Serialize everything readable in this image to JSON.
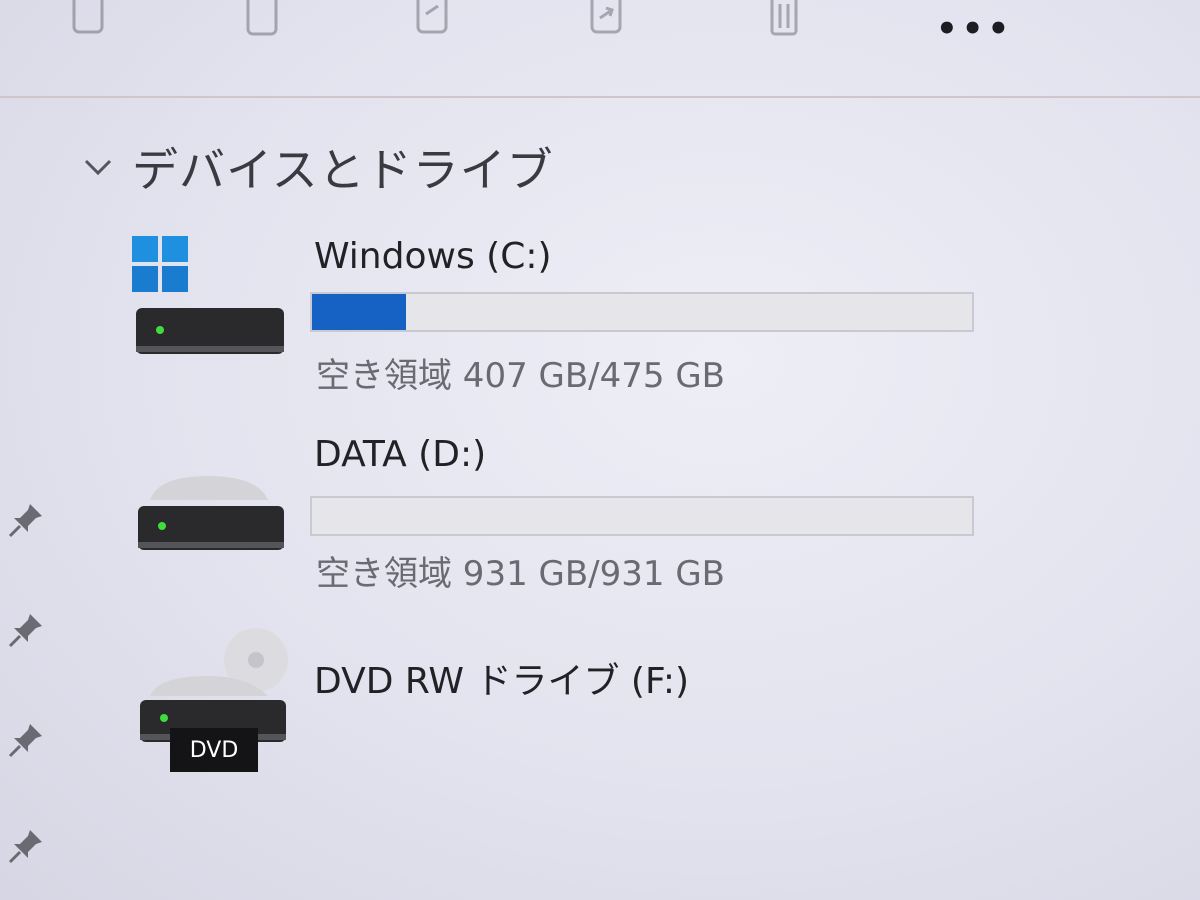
{
  "toolbar": {
    "icons": [
      "cut-icon",
      "copy-icon",
      "rename-icon",
      "share-icon",
      "delete-icon"
    ],
    "more_label": "•••"
  },
  "section": {
    "title": "デバイスとドライブ",
    "expanded": true
  },
  "drives": [
    {
      "name": "Windows (C:)",
      "space_text": "空き領域 407 GB/475 GB",
      "used_fraction": 0.143,
      "icon": "windows-drive-icon"
    },
    {
      "name": "DATA (D:)",
      "space_text": "空き領域 931 GB/931 GB",
      "used_fraction": 0.0,
      "icon": "hard-drive-icon"
    },
    {
      "name": "DVD RW ドライブ (F:)",
      "icon": "dvd-drive-icon",
      "badge": "DVD"
    }
  ],
  "colors": {
    "accent": "#1562c4",
    "led": "#3fdc3f",
    "windows_logo": "#1f8fe0"
  }
}
